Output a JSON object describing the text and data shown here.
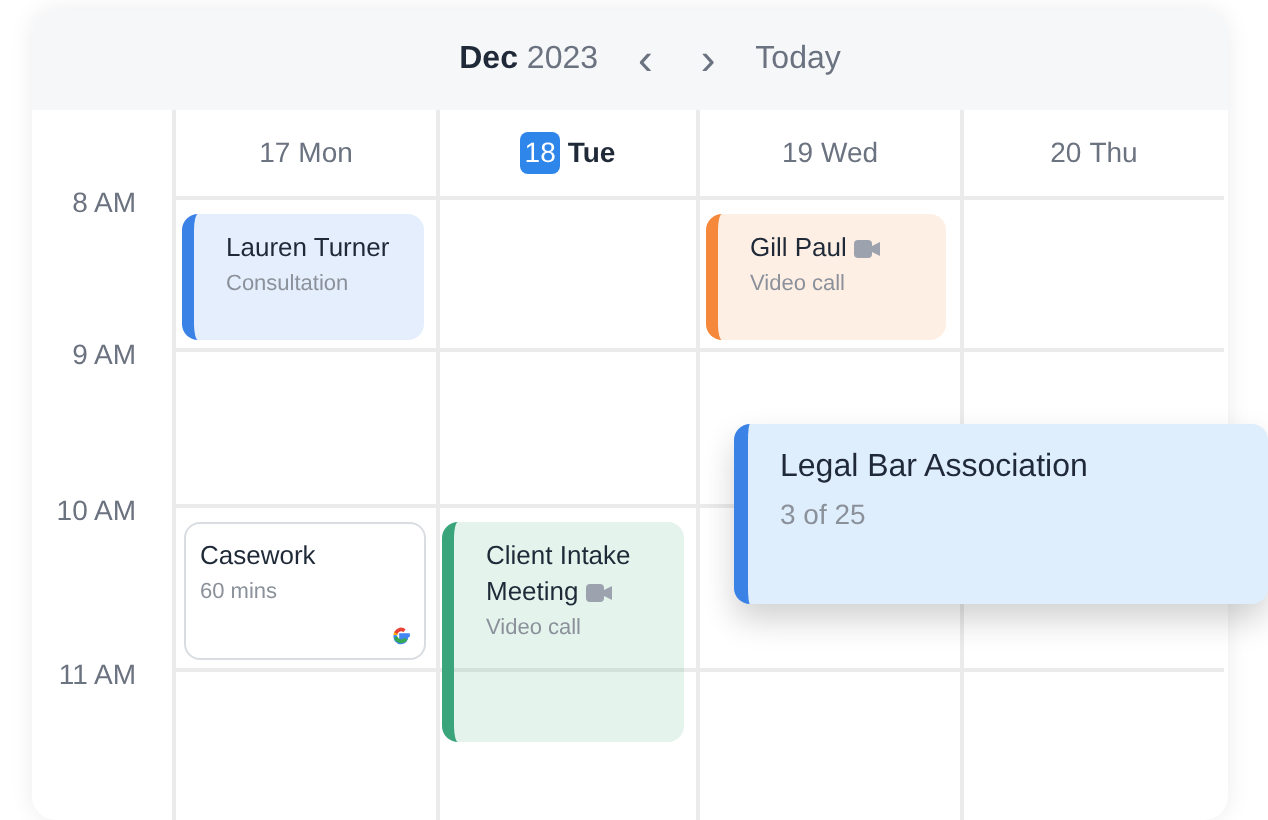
{
  "header": {
    "month": "Dec",
    "year": "2023",
    "prev": "‹",
    "next": "›",
    "today": "Today"
  },
  "days": [
    {
      "number": "17",
      "weekday": "Mon",
      "selected": false
    },
    {
      "number": "18",
      "weekday": "Tue",
      "selected": true
    },
    {
      "number": "19",
      "weekday": "Wed",
      "selected": false
    },
    {
      "number": "20",
      "weekday": "Thu",
      "selected": false
    }
  ],
  "hours": [
    "8 AM",
    "9 AM",
    "10 AM",
    "11 AM"
  ],
  "events": [
    {
      "kind": "filled",
      "title": "Lauren Turner",
      "subtitle": "Consultation",
      "color": "#3b82e6",
      "video": false
    },
    {
      "kind": "filled",
      "title": "Gill Paul",
      "subtitle": "Video call",
      "color": "#f5883a",
      "video": true
    },
    {
      "kind": "outlined",
      "title": "Casework",
      "subtitle": "60 mins",
      "google": true
    },
    {
      "kind": "filled",
      "title": "Client Intake Meeting",
      "subtitle": "Video call",
      "color": "#3aa57a",
      "video": true
    },
    {
      "kind": "floating",
      "title": "Legal Bar Association",
      "subtitle": "3 of 25",
      "color": "#3b82e6"
    }
  ]
}
